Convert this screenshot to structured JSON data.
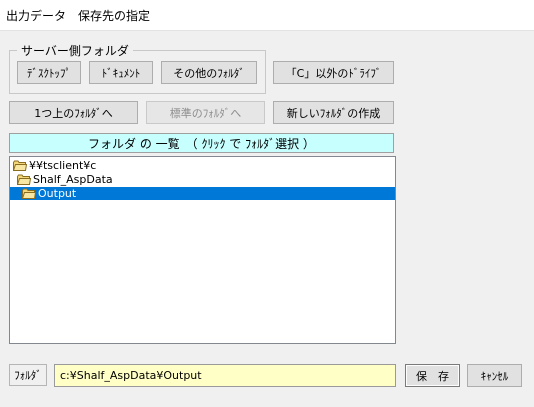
{
  "window": {
    "title": "出力データ　保存先の指定"
  },
  "server_group": {
    "legend": "サーバー側フォルダ",
    "buttons": {
      "desktop": "ﾃﾞｽｸﾄｯﾌﾟ",
      "documents": "ﾄﾞｷｭﾒﾝﾄ",
      "other_folder": "その他のﾌｫﾙﾀﾞ"
    }
  },
  "toolbar": {
    "other_drive": "「C」以外のﾄﾞﾗｲﾌﾞ",
    "up_folder": "1つ上のﾌｫﾙﾀﾞへ",
    "standard_folder": "標準のﾌｫﾙﾀﾞへ",
    "new_folder": "新しいﾌｫﾙﾀﾞの作成"
  },
  "folder_list": {
    "header": "フォルダ の 一覧　（ ｸﾘｯｸ で ﾌｫﾙﾀﾞ選択 ）",
    "items": [
      {
        "label": "¥¥tsclient¥c",
        "depth": 0,
        "selected": false
      },
      {
        "label": "Shalf_AspData",
        "depth": 1,
        "selected": false
      },
      {
        "label": "Output",
        "depth": 2,
        "selected": true
      }
    ]
  },
  "footer": {
    "folder_label": "ﾌｫﾙﾀﾞ",
    "path_value": "c:¥Shalf_AspData¥Output",
    "save": "保　存",
    "cancel": "ｷｬﾝｾﾙ"
  },
  "colors": {
    "header_bg": "#c7ffff",
    "path_bg": "#ffffc6",
    "selection": "#0078d7"
  }
}
